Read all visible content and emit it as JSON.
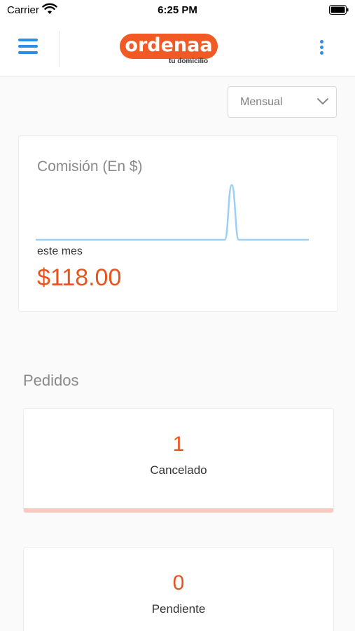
{
  "status_bar": {
    "carrier": "Carrier",
    "time": "6:25 PM",
    "icons": [
      "wifi-icon",
      "battery-icon"
    ]
  },
  "header": {
    "menu_icon": "hamburger-menu-icon",
    "logo_text": "ordenaa",
    "logo_tagline": "tu domicilio",
    "more_icon": "vertical-dots-icon",
    "accent_color": "#2e8de6",
    "brand_color": "#f15a24"
  },
  "filter": {
    "selected": "Mensual",
    "icon": "chevron-down-icon"
  },
  "commission": {
    "title": "Comisión (En $)",
    "period_label": "este mes",
    "value": "$118.00",
    "sparkline_color": "#9ccff5"
  },
  "chart_data": {
    "type": "line",
    "series": [
      {
        "values": [
          0,
          0,
          0,
          0,
          0,
          0,
          0,
          0,
          0,
          0,
          0,
          0,
          0,
          0,
          0,
          0,
          0,
          0,
          0,
          0,
          0,
          0,
          0,
          0,
          0,
          0,
          0,
          0,
          118,
          0,
          0,
          0,
          0,
          0,
          0,
          0,
          0,
          0,
          0,
          0
        ]
      }
    ],
    "grid": false,
    "legend": "none"
  },
  "orders": {
    "title": "Pedidos",
    "items": [
      {
        "count": "1",
        "label": "Cancelado",
        "bar_color": "#f8c9c1"
      },
      {
        "count": "0",
        "label": "Pendiente"
      }
    ],
    "value_color": "#e8541e"
  }
}
